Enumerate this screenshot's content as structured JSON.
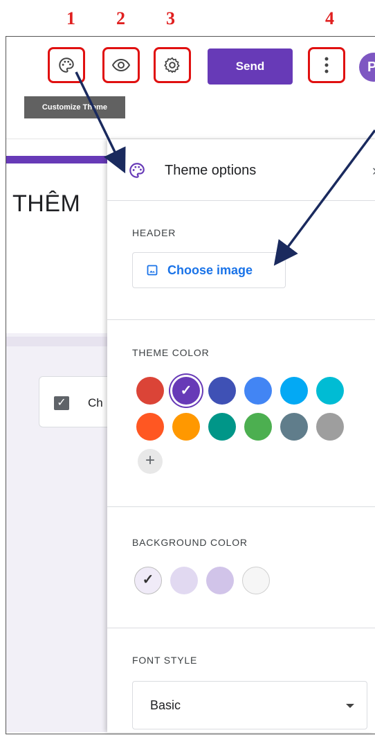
{
  "annotations": [
    "1",
    "2",
    "3",
    "4"
  ],
  "toolbar": {
    "customize_icon": "palette-icon",
    "preview_icon": "eye-icon",
    "settings_icon": "gear-icon",
    "send_label": "Send",
    "more_icon": "more-vert-icon",
    "avatar_initial": "P",
    "tooltip": "Customize Theme"
  },
  "form": {
    "title": "THÊM",
    "question_label": "Ch",
    "accent_color": "#673ab7"
  },
  "panel": {
    "title": "Theme options",
    "close_glyph": "›",
    "header": {
      "label": "HEADER",
      "button_label": "Choose image",
      "button_icon": "image-icon"
    },
    "theme_color": {
      "label": "THEME COLOR",
      "selected_index": 1,
      "colors": [
        "#db4437",
        "#673ab7",
        "#3f51b5",
        "#4285f4",
        "#03a9f4",
        "#00bcd4",
        "#ff5722",
        "#ff9800",
        "#009688",
        "#4caf50",
        "#607d8b",
        "#9e9e9e"
      ],
      "add_label": "+"
    },
    "background_color": {
      "label": "BACKGROUND COLOR",
      "selected_index": 0,
      "colors": [
        "#f0ebf8",
        "#e1d9f1",
        "#d1c4e9",
        "#f6f6f6"
      ]
    },
    "font_style": {
      "label": "FONT STYLE",
      "value": "Basic"
    }
  }
}
